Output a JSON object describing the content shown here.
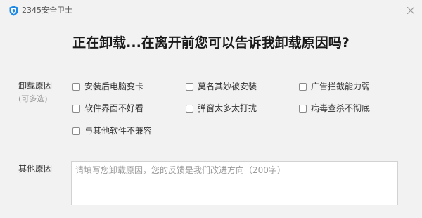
{
  "window": {
    "title": "2345安全卫士",
    "logo_icon": "shield-logo-icon",
    "close_icon": "close-icon",
    "colors": {
      "background": "#f2f2f2",
      "logo": "#1e88e5"
    }
  },
  "header": {
    "question": "正在卸载...在离开前您可以告诉我卸载原因吗?"
  },
  "reasons": {
    "label": "卸载原因",
    "hint": "(可多选)",
    "options": [
      {
        "label": "安装后电脑变卡",
        "checked": false
      },
      {
        "label": "莫名其妙被安装",
        "checked": false
      },
      {
        "label": "广告拦截能力弱",
        "checked": false
      },
      {
        "label": "软件界面不好看",
        "checked": false
      },
      {
        "label": "弹窗太多太打扰",
        "checked": false
      },
      {
        "label": "病毒查杀不彻底",
        "checked": false
      },
      {
        "label": "与其他软件不兼容",
        "checked": false
      }
    ]
  },
  "other": {
    "label": "其他原因",
    "value": "",
    "placeholder": "请填写您卸载原因，您的反馈是我们改进方向（200字）"
  }
}
